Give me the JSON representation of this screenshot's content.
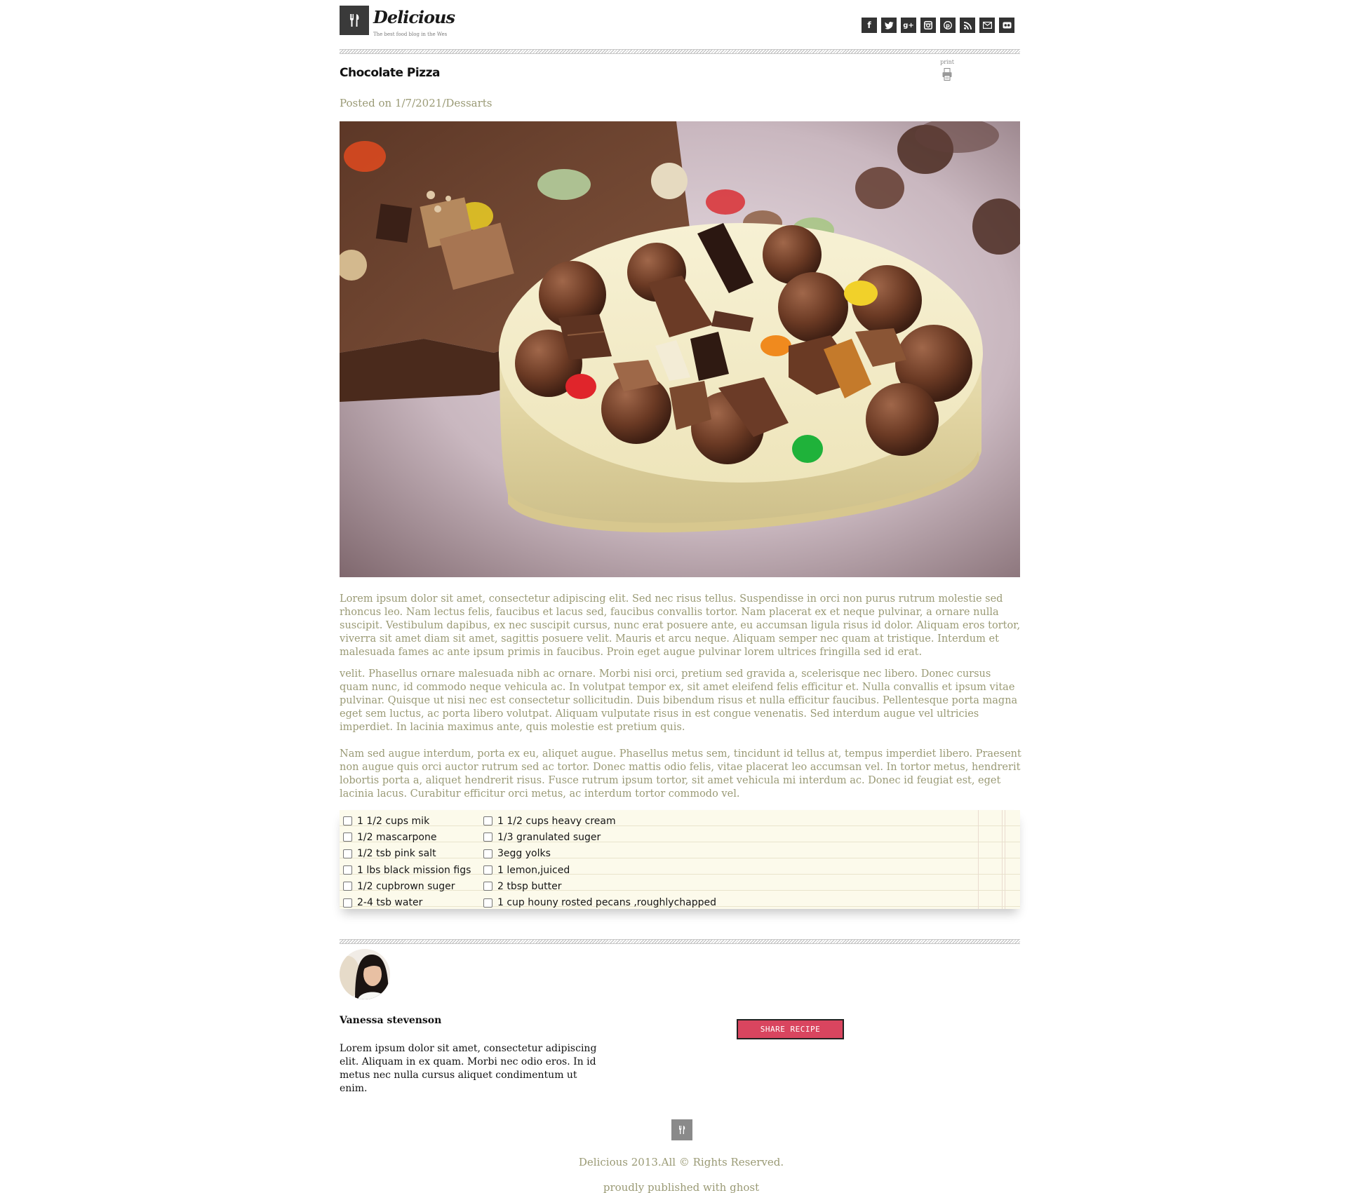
{
  "header": {
    "brand": "Delicious",
    "tagline": "The best food blog in the Wes",
    "social_icons": [
      "facebook-icon",
      "twitter-icon",
      "google-plus-icon",
      "instagram-icon",
      "pinterest-icon",
      "rss-icon",
      "mail-icon",
      "flickr-icon"
    ]
  },
  "post": {
    "title": "Chocolate Pizza",
    "print_label": "print",
    "posted": "Posted on 1/7/2021/Dessarts",
    "paragraphs": [
      "Lorem ipsum dolor sit amet, consectetur adipiscing elit. Sed nec risus tellus. Suspendisse in orci non purus rutrum molestie sed rhoncus leo. Nam lectus felis, faucibus et lacus sed, faucibus convallis tortor. Nam placerat ex et neque pulvinar, a ornare nulla suscipit. Vestibulum dapibus, ex nec suscipit cursus, nunc erat posuere ante, eu accumsan ligula risus id dolor. Aliquam eros tortor, viverra sit amet diam sit amet, sagittis posuere velit. Mauris et arcu neque. Aliquam semper nec quam at tristique. Interdum et malesuada fames ac ante ipsum primis in faucibus. Proin eget augue pulvinar lorem ultrices fringilla sed id erat.",
      "velit. Phasellus ornare malesuada nibh ac ornare. Morbi nisi orci, pretium sed gravida a, scelerisque nec libero. Donec cursus quam nunc, id commodo neque vehicula ac. In volutpat tempor ex, sit amet eleifend felis efficitur et. Nulla convallis et ipsum vitae pulvinar. Quisque ut nisi nec est consectetur sollicitudin. Duis bibendum risus et nulla efficitur faucibus. Pellentesque porta magna eget sem luctus, ac porta libero volutpat. Aliquam vulputate risus in est congue venenatis. Sed interdum augue vel ultricies imperdiet. In lacinia maximus ante, quis molestie est pretium quis.",
      "Nam sed augue interdum, porta ex eu, aliquet augue. Phasellus metus sem, tincidunt id tellus at, tempus imperdiet libero. Praesent non augue quis orci auctor rutrum sed ac tortor. Donec mattis odio felis, vitae placerat leo accumsan vel. In tortor metus, hendrerit lobortis porta a, aliquet hendrerit risus. Fusce rutrum ipsum tortor, sit amet vehicula mi interdum ac. Donec id feugiat est, eget lacinia lacus. Curabitur efficitur orci metus, ac interdum tortor commodo vel."
    ],
    "ingredients_left": [
      "1 1/2 cups mik",
      "1/2 mascarpone",
      "1/2 tsb pink salt",
      "1 lbs black mission figs",
      "1/2 cupbrown suger",
      "2-4 tsb water"
    ],
    "ingredients_right": [
      "1 1/2 cups heavy cream",
      "1/3 granulated suger",
      "3egg yolks",
      "1 lemon,juiced",
      "2 tbsp butter",
      "1 cup houny rosted pecans ,roughlychapped"
    ]
  },
  "author": {
    "name": "Vanessa stevenson",
    "bio": "Lorem ipsum dolor sit amet, consectetur adipiscing elit. Aliquam in ex quam. Morbi nec odio eros. In id metus nec nulla cursus aliquet condimentum ut enim."
  },
  "share_label": "SHARE RECIPE",
  "footer": {
    "copyright": "Delicious 2013.All © Rights Reserved.",
    "published": "proudly published with ghost"
  },
  "colors": {
    "accent": "#d9455f",
    "text_muted": "#9a9a75",
    "logo_bg": "#3a3a3a",
    "paper": "#fcfaeb"
  }
}
